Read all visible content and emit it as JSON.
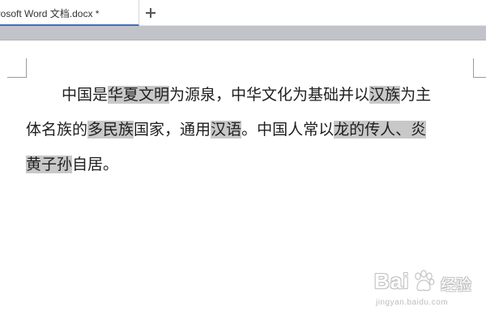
{
  "tabs": [
    {
      "title": "Microsoft Word 文档.docx *",
      "active": true
    }
  ],
  "new_tab_symbol": "+",
  "document": {
    "lines": [
      [
        {
          "text": "中国是",
          "highlight": false
        },
        {
          "text": "华夏文明",
          "highlight": true
        },
        {
          "text": "为源泉，中华文化为基础并以",
          "highlight": false
        },
        {
          "text": "汉族",
          "highlight": true
        },
        {
          "text": "为主",
          "highlight": false
        }
      ],
      [
        {
          "text": "体名族的",
          "highlight": false
        },
        {
          "text": "多民族",
          "highlight": true
        },
        {
          "text": "国家，通用",
          "highlight": false
        },
        {
          "text": "汉语",
          "highlight": true
        },
        {
          "text": "。中国人常以",
          "highlight": false
        },
        {
          "text": "龙的传人、炎",
          "highlight": true
        }
      ],
      [
        {
          "text": "黄子孙",
          "highlight": true
        },
        {
          "text": "自居。",
          "highlight": false
        }
      ]
    ],
    "highlight_color": "#c8c8c8"
  },
  "watermark": {
    "brand_text": "Bai",
    "paw_icon": "baidu-paw-icon",
    "product_text": "经验",
    "url_text": "jingyan.baidu.com"
  },
  "colors": {
    "tab_accent": "#3d6fc2",
    "toolbar_band": "#c2c3c8",
    "text": "#1e1e1e"
  }
}
